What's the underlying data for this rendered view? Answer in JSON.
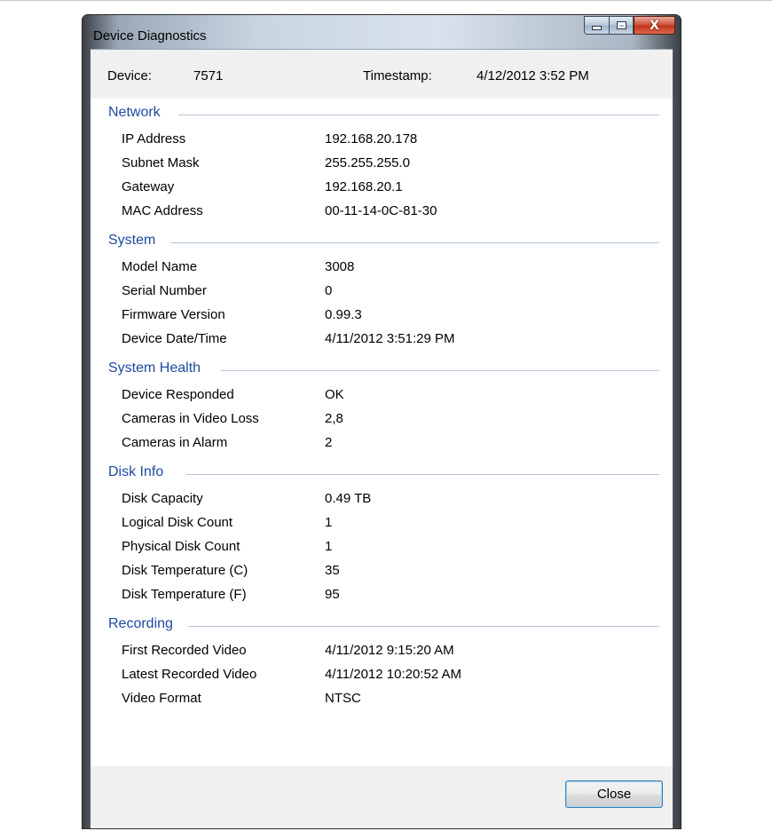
{
  "window": {
    "title": "Device Diagnostics",
    "caption_close_glyph": "X"
  },
  "header": {
    "device_label": "Device:",
    "device_value": "7571",
    "timestamp_label": "Timestamp:",
    "timestamp_value": "4/12/2012 3:52 PM"
  },
  "sections": {
    "network": {
      "title": "Network",
      "rows": [
        {
          "label": "IP Address",
          "value": "192.168.20.178"
        },
        {
          "label": "Subnet Mask",
          "value": "255.255.255.0"
        },
        {
          "label": "Gateway",
          "value": "192.168.20.1"
        },
        {
          "label": "MAC Address",
          "value": "00-11-14-0C-81-30"
        }
      ]
    },
    "system": {
      "title": "System",
      "rows": [
        {
          "label": "Model Name",
          "value": "3008"
        },
        {
          "label": "Serial Number",
          "value": "0"
        },
        {
          "label": "Firmware Version",
          "value": "0.99.3"
        },
        {
          "label": "Device Date/Time",
          "value": "4/11/2012 3:51:29 PM"
        }
      ]
    },
    "health": {
      "title": "System Health",
      "rows": [
        {
          "label": "Device Responded",
          "value": "OK"
        },
        {
          "label": "Cameras in Video Loss",
          "value": "2,8"
        },
        {
          "label": "Cameras in Alarm",
          "value": "2"
        }
      ]
    },
    "disk": {
      "title": "Disk Info",
      "rows": [
        {
          "label": "Disk Capacity",
          "value": "0.49 TB"
        },
        {
          "label": "Logical Disk Count",
          "value": "1"
        },
        {
          "label": "Physical Disk Count",
          "value": "1"
        },
        {
          "label": "Disk Temperature (C)",
          "value": "35"
        },
        {
          "label": "Disk Temperature (F)",
          "value": "95"
        }
      ]
    },
    "recording": {
      "title": "Recording",
      "rows": [
        {
          "label": "First Recorded Video",
          "value": "4/11/2012 9:15:20 AM"
        },
        {
          "label": "Latest Recorded Video",
          "value": "4/11/2012 10:20:52 AM"
        },
        {
          "label": "Video Format",
          "value": "NTSC"
        }
      ]
    }
  },
  "footer": {
    "close_label": "Close"
  }
}
